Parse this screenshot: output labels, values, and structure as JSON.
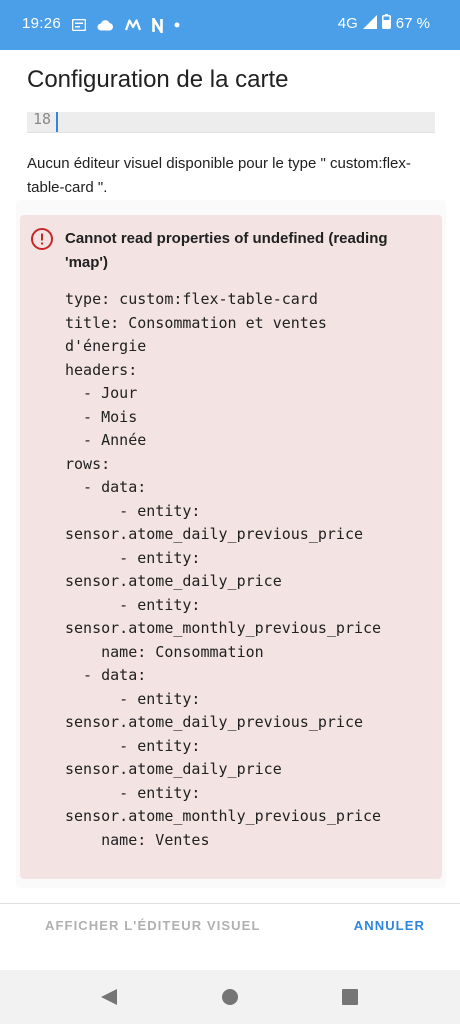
{
  "status_bar": {
    "time": "19:26",
    "network": "4G",
    "battery": "67 %",
    "icons": [
      "notification-icon",
      "cloud-icon",
      "m-app-icon",
      "n-app-icon",
      "dot-icon",
      "signal-icon",
      "battery-icon"
    ]
  },
  "dialog": {
    "title": "Configuration de la carte"
  },
  "editor": {
    "line_number": "18"
  },
  "message": "Aucun éditeur visuel disponible pour le type \" custom:flex-table-card \".",
  "error_card": {
    "title": "Cannot read properties of undefined (reading 'map')",
    "icon": "alert-circle-icon",
    "color": "#c62828",
    "background": "#f3e4e3",
    "yaml": "type: custom:flex-table-card\ntitle: Consommation et ventes\nd'énergie\nheaders:\n  - Jour\n  - Mois\n  - Année\nrows:\n  - data:\n      - entity:\nsensor.atome_daily_previous_price\n      - entity:\nsensor.atome_daily_price\n      - entity:\nsensor.atome_monthly_previous_price\n    name: Consommation\n  - data:\n      - entity:\nsensor.atome_daily_previous_price\n      - entity:\nsensor.atome_daily_price\n      - entity:\nsensor.atome_monthly_previous_price\n    name: Ventes"
  },
  "actions": {
    "show_editor_label": "AFFICHER L'ÉDITEUR VISUEL",
    "cancel_label": "ANNULER"
  },
  "colors": {
    "status_bar": "#4a9fe8",
    "accent": "#2e86de",
    "disabled": "#b0b0b0"
  }
}
